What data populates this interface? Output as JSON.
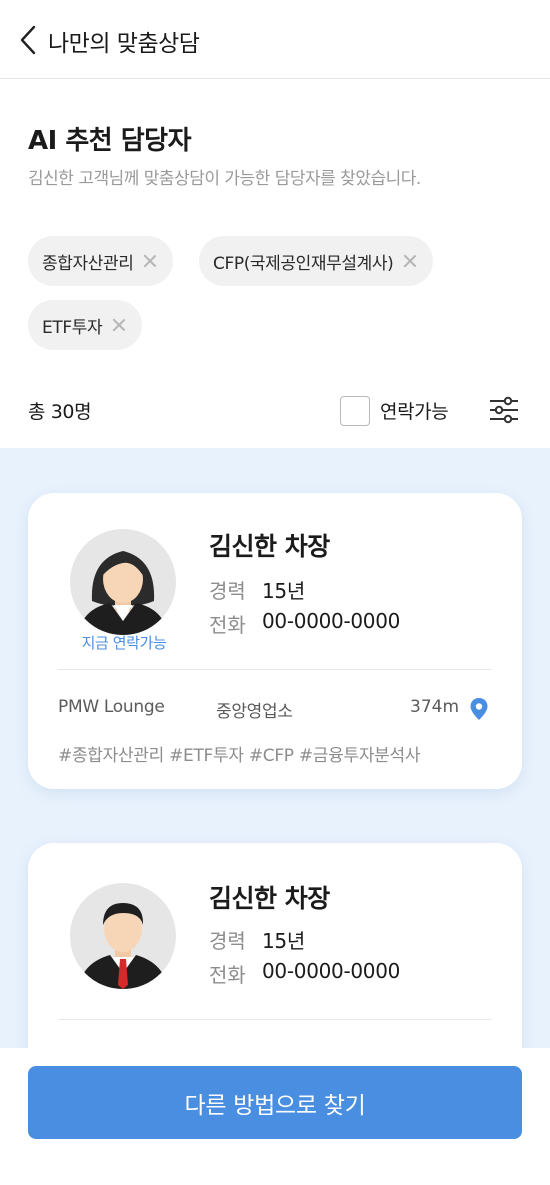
{
  "header": {
    "title": "나만의 맞춤상담",
    "back_icon": "chevron-left-icon"
  },
  "section": {
    "title": "AI 추천 담당자",
    "subtitle": "김신한 고객님께 맞춤상담이 가능한 담당자를 찾았습니다."
  },
  "filters": [
    "종합자산관리",
    "CFP(국제공인재무설계사)",
    "ETF투자"
  ],
  "toolbar": {
    "count": "총 30명",
    "checkbox_label": "연락가능",
    "checkbox_checked": false,
    "filter_icon": "sliders-icon"
  },
  "cards": [
    {
      "name": "김신한 차장",
      "status": "지금 연락가능",
      "career_label": "경력",
      "career_value": "15년",
      "phone_label": "전화",
      "phone_value": "00-0000-0000",
      "branch": "PMW Lounge",
      "office": "중앙영업소",
      "distance": "374m",
      "tags": "#종합자산관리  #ETF투자  #CFP  #금융투자분석사"
    },
    {
      "name": "김신한 차장",
      "career_label": "경력",
      "career_value": "15년",
      "phone_label": "전화",
      "phone_value": "00-0000-0000"
    }
  ],
  "cta": {
    "label": "다른 방법으로 찾기"
  },
  "colors": {
    "accent": "#4a8ee2",
    "list_bg": "#e8f2fd",
    "chip_bg": "#f1f1f1"
  }
}
